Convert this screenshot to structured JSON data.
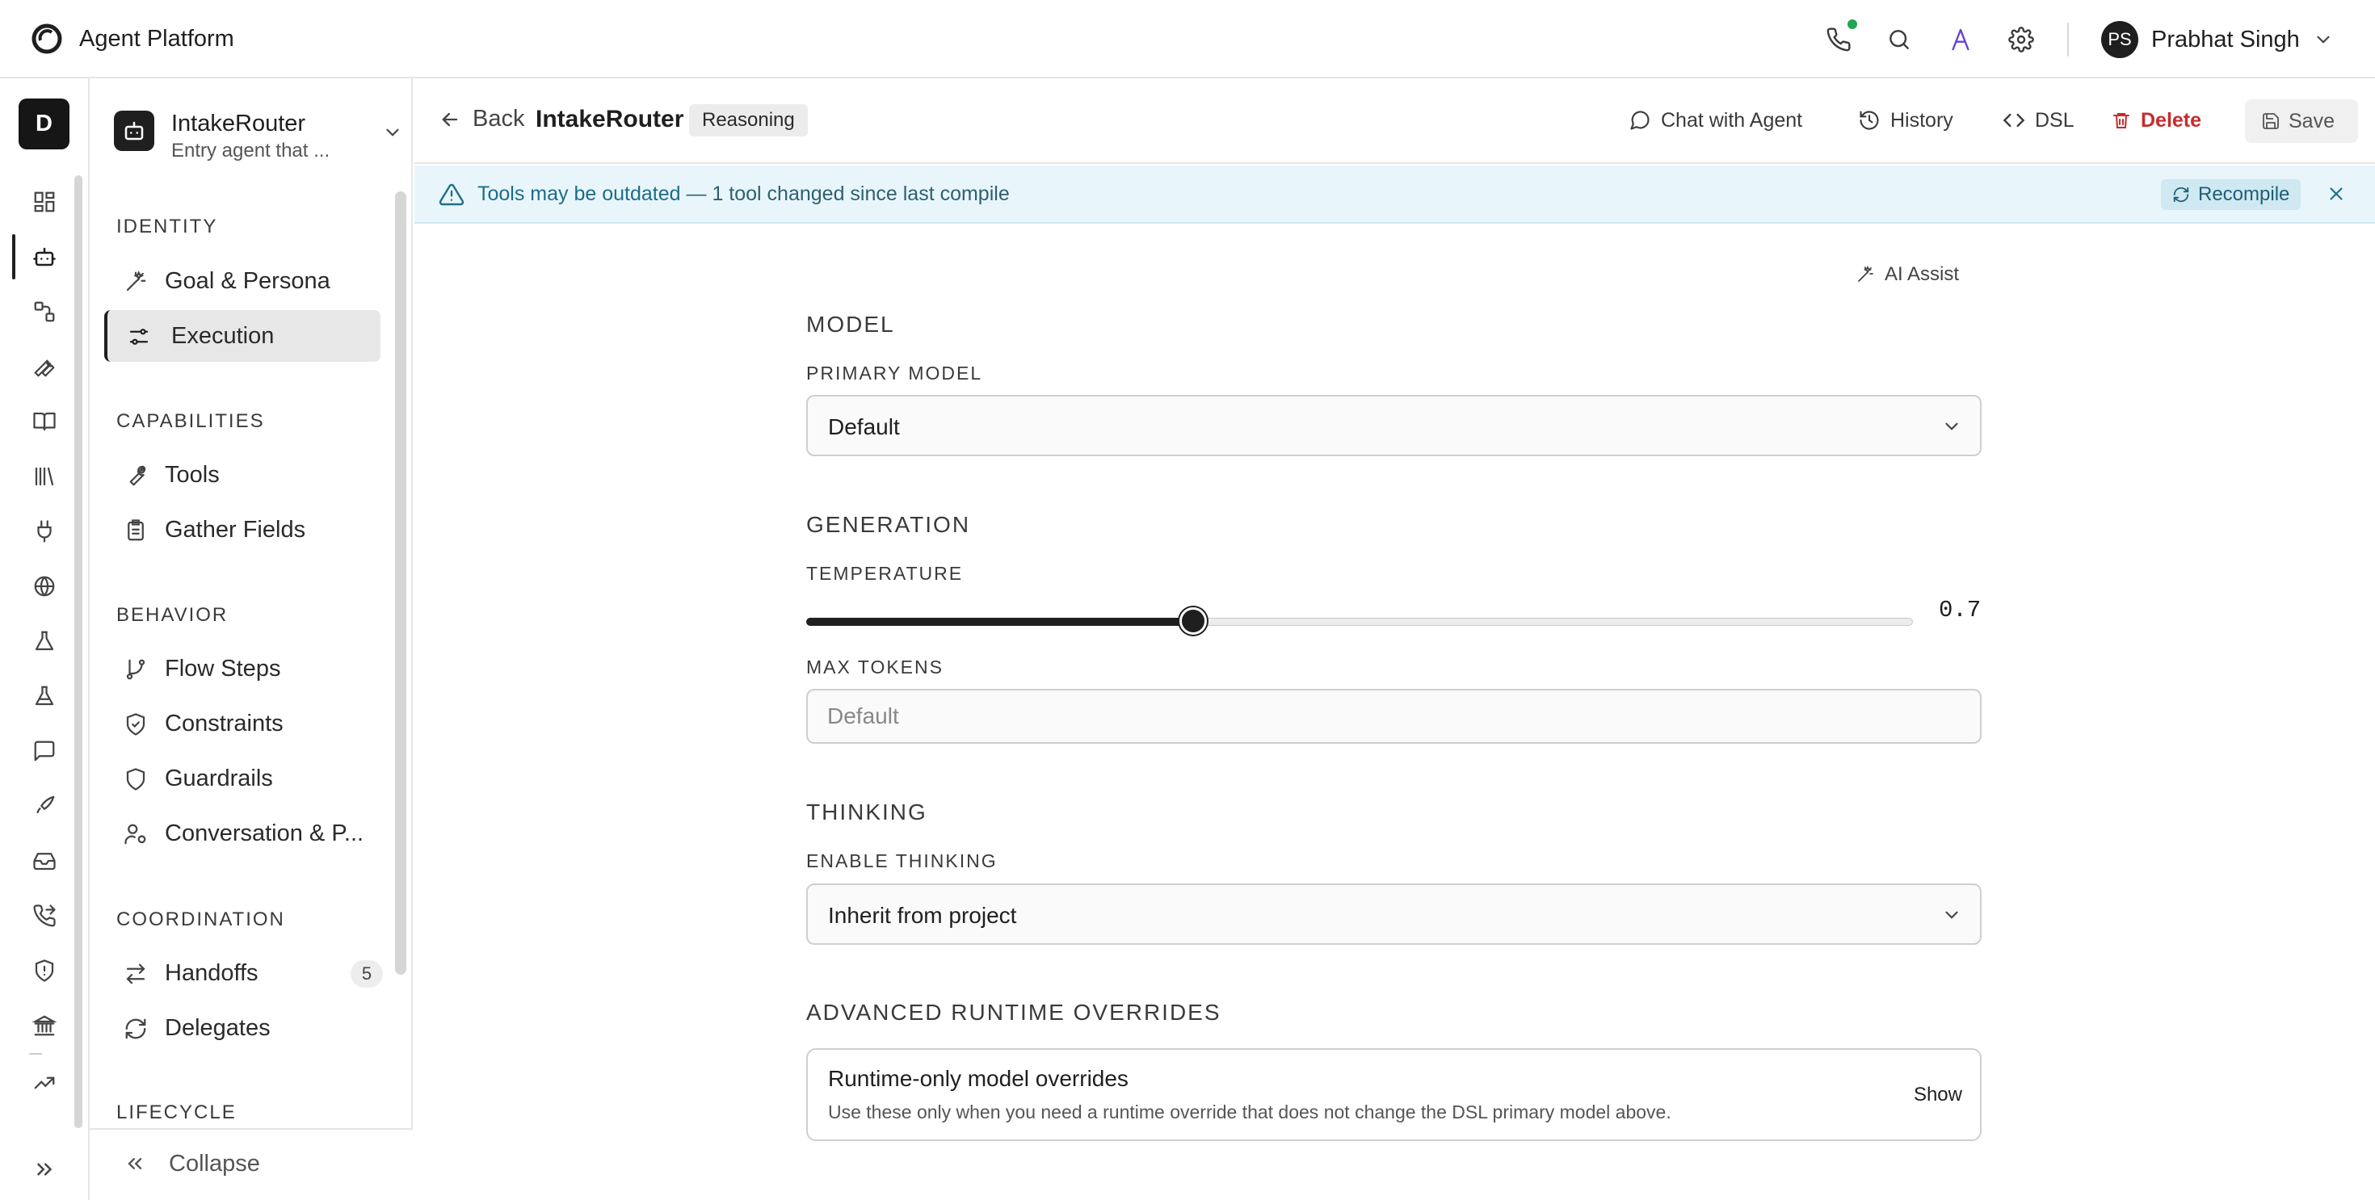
{
  "app": {
    "title": "Agent Platform"
  },
  "user": {
    "initials": "PS",
    "name": "Prabhat Singh"
  },
  "workspace": {
    "initial": "D"
  },
  "agent": {
    "name": "IntakeRouter",
    "description": "Entry agent that ..."
  },
  "sidebar": {
    "sections": {
      "identity": "IDENTITY",
      "capabilities": "CAPABILITIES",
      "behavior": "BEHAVIOR",
      "coordination": "COORDINATION",
      "lifecycle": "LIFECYCLE"
    },
    "items": {
      "goal": "Goal & Persona",
      "execution": "Execution",
      "tools": "Tools",
      "gather": "Gather Fields",
      "flow": "Flow Steps",
      "constraints": "Constraints",
      "guardrails": "Guardrails",
      "conversation": "Conversation & P...",
      "handoffs": "Handoffs",
      "handoffs_count": "5",
      "delegates": "Delegates"
    },
    "collapse": "Collapse"
  },
  "header": {
    "back": "Back",
    "title": "IntakeRouter",
    "badge": "Reasoning",
    "chat": "Chat with Agent",
    "history": "History",
    "dsl": "DSL",
    "delete": "Delete",
    "save": "Save"
  },
  "banner": {
    "strong": "Tools may be outdated",
    "rest": " — 1 tool changed since last compile",
    "recompile": "Recompile"
  },
  "form": {
    "ai_assist": "AI Assist",
    "model_section": "MODEL",
    "primary_model_label": "PRIMARY MODEL",
    "primary_model_value": "Default",
    "generation_section": "GENERATION",
    "temperature_label": "TEMPERATURE",
    "temperature_value": "0.7",
    "temperature_fraction": 0.35,
    "max_tokens_label": "MAX TOKENS",
    "max_tokens_placeholder": "Default",
    "thinking_section": "THINKING",
    "enable_thinking_label": "ENABLE THINKING",
    "enable_thinking_value": "Inherit from project",
    "advanced_section": "ADVANCED RUNTIME OVERRIDES",
    "override_title": "Runtime-only model overrides",
    "override_desc": "Use these only when you need a runtime override that does not change the DSL primary model above.",
    "override_show": "Show"
  },
  "colors": {
    "accent": "#1f1f1f",
    "danger": "#c92a2a",
    "banner_bg": "#e8f6fb",
    "online": "#22a555",
    "brand_purple": "#6a3fd6"
  }
}
